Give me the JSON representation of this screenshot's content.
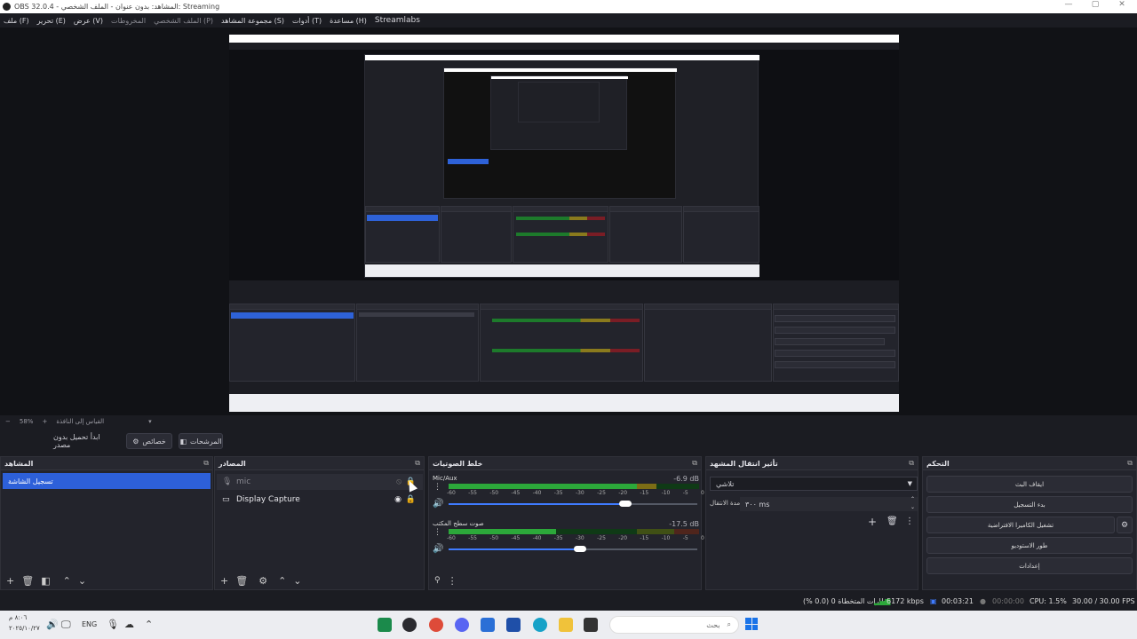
{
  "window": {
    "title": "OBS 32.0.4 - المشاهد: بدون عنوان - الملف الشخصي: Streaming",
    "controls": [
      "—",
      "▢",
      "✕"
    ]
  },
  "menu": {
    "items": [
      "ملف (F)",
      "تحرير (E)",
      "عرض (V)",
      "المخروطات",
      "الملف الشخصي (P)",
      "مجموعة المشاهد (S)",
      "أدوات (T)",
      "مساعدة (H)",
      "Streamlabs"
    ]
  },
  "preview": {
    "zoom": "58%",
    "scale_label": "القياس إلى النافذة"
  },
  "controls_bar": {
    "virtual_camera_btn": "ابدأ تحميل بدون مصدر",
    "settings_btn": "خصائص",
    "filters_btn": "المرشحات"
  },
  "docks": {
    "scenes": {
      "title": "المشاهد",
      "items": [
        "تسجيل الشاشة"
      ]
    },
    "sources": {
      "title": "المصادر",
      "items": [
        {
          "label": "mic",
          "icon": "mic-icon",
          "visible": false
        },
        {
          "label": "Display Capture",
          "icon": "monitor-icon",
          "visible": true
        }
      ]
    },
    "mixer": {
      "title": "خلط الصوتيات",
      "channels": [
        {
          "name": "Mic/Aux",
          "db": "-6.9 dB",
          "level": 0.83,
          "volume": 0.71
        },
        {
          "name": "صوت سطح المكتب",
          "db": "-17.5 dB",
          "level": 0.43,
          "volume": 0.53
        }
      ],
      "ticks": [
        "-60",
        "-55",
        "-50",
        "-45",
        "-40",
        "-35",
        "-30",
        "-25",
        "-20",
        "-15",
        "-10",
        "-5",
        "0"
      ]
    },
    "transitions": {
      "title": "تأثير انتقال المشهد",
      "selected": "تلاشي",
      "duration_label": "مدة الانتقال",
      "duration_value": "٣٠٠ ms"
    },
    "controls": {
      "title": "التحكم",
      "buttons": [
        "ايقاف البث",
        "بدء التسجيل",
        "تشغيل الكاميرا الافتراضية",
        "طور الاستوديو",
        "إعدادات"
      ]
    }
  },
  "status": {
    "dropped": "إطارات المتخطاة 0 (0.0 %)",
    "bitrate": "6172 kbps",
    "stream_time": "00:03:21",
    "record_time": "00:00:00",
    "cpu": "CPU: 1.5%",
    "fps": "30.00 / 30.00 FPS"
  },
  "taskbar": {
    "clock_time": "٨:٠٦ م",
    "clock_date": "٢٠٢٥/١٠/٢٧",
    "lang": "ENG",
    "search_placeholder": "بحث"
  },
  "colors": {
    "accent": "#2d60d9",
    "dock_bg": "#23242c",
    "meter_green": "#2ca83a",
    "meter_yellow": "#7c6d15",
    "meter_red": "#7a1822"
  }
}
